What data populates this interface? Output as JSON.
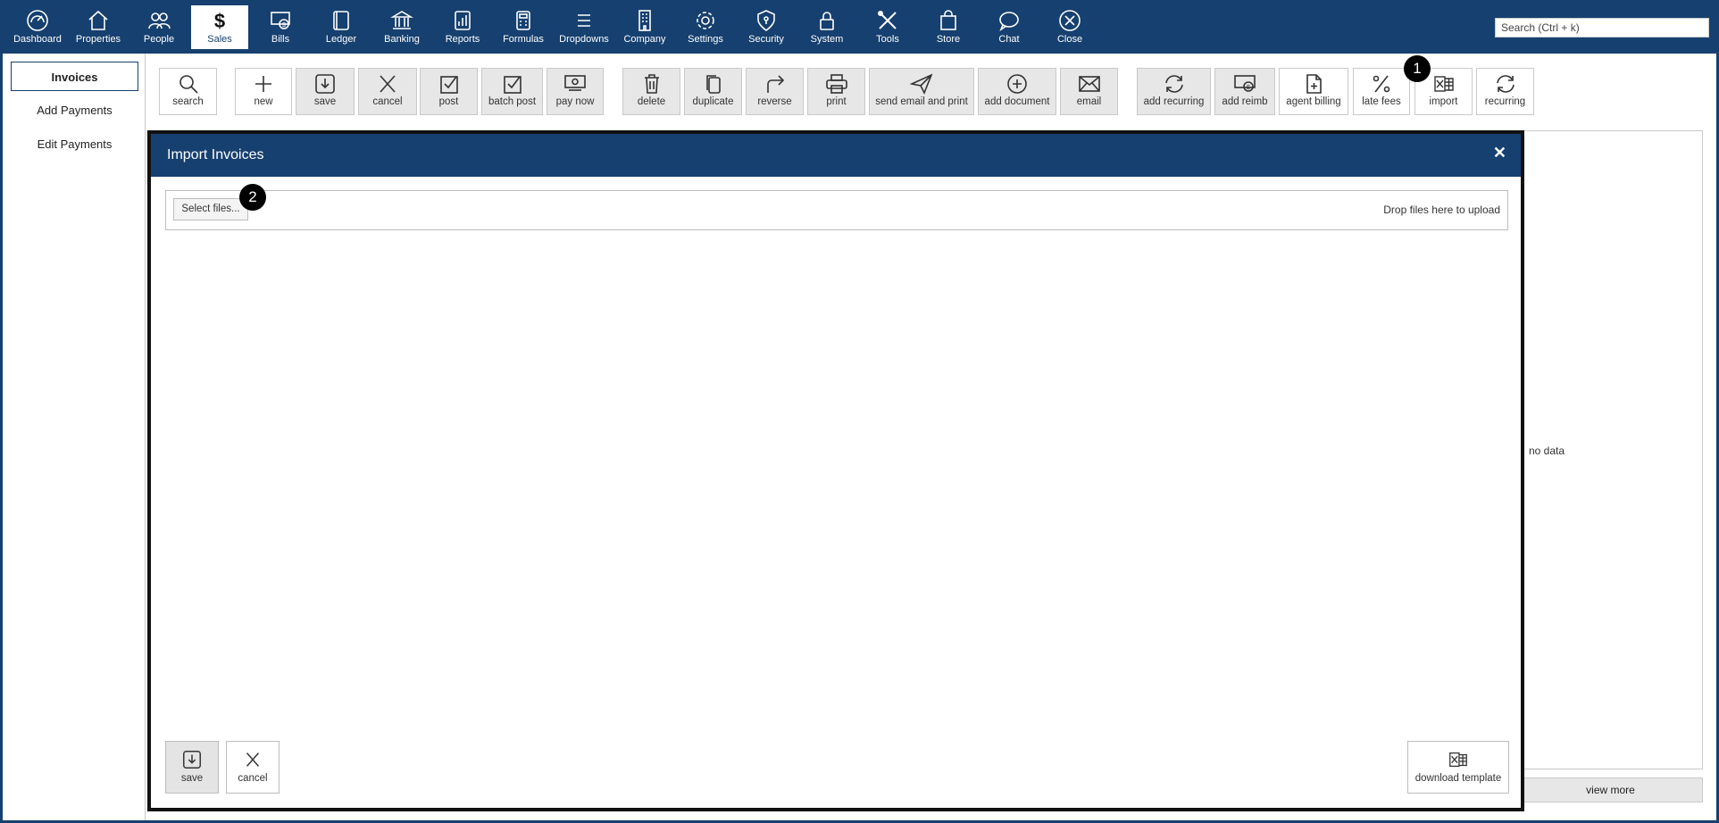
{
  "nav": {
    "items": [
      {
        "label": "Dashboard",
        "icon": "dashboard-icon"
      },
      {
        "label": "Properties",
        "icon": "home-icon"
      },
      {
        "label": "People",
        "icon": "people-icon"
      },
      {
        "label": "Sales",
        "icon": "dollar-icon",
        "active": true
      },
      {
        "label": "Bills",
        "icon": "bill-icon"
      },
      {
        "label": "Ledger",
        "icon": "ledger-icon"
      },
      {
        "label": "Banking",
        "icon": "bank-icon"
      },
      {
        "label": "Reports",
        "icon": "reports-icon"
      },
      {
        "label": "Formulas",
        "icon": "calculator-icon"
      },
      {
        "label": "Dropdowns",
        "icon": "list-icon"
      },
      {
        "label": "Company",
        "icon": "building-icon"
      },
      {
        "label": "Settings",
        "icon": "gear-icon"
      },
      {
        "label": "Security",
        "icon": "shield-icon"
      },
      {
        "label": "System",
        "icon": "lock-icon"
      },
      {
        "label": "Tools",
        "icon": "tools-icon"
      },
      {
        "label": "Store",
        "icon": "bag-icon"
      },
      {
        "label": "Chat",
        "icon": "chat-icon"
      },
      {
        "label": "Close",
        "icon": "close-circle-icon"
      }
    ],
    "search_placeholder": "Search (Ctrl + k)"
  },
  "sidebar": {
    "items": [
      {
        "label": "Invoices",
        "active": true
      },
      {
        "label": "Add Payments"
      },
      {
        "label": "Edit Payments"
      }
    ]
  },
  "toolbar": {
    "buttons": [
      {
        "label": "search",
        "icon": "search-icon"
      },
      {
        "label": "new",
        "icon": "plus-icon"
      },
      {
        "label": "save",
        "icon": "save-icon"
      },
      {
        "label": "cancel",
        "icon": "x-icon"
      },
      {
        "label": "post",
        "icon": "check-box-icon"
      },
      {
        "label": "batch post",
        "icon": "check-box-icon"
      },
      {
        "label": "pay now",
        "icon": "money-icon"
      },
      {
        "label": "delete",
        "icon": "trash-icon"
      },
      {
        "label": "duplicate",
        "icon": "copy-icon"
      },
      {
        "label": "reverse",
        "icon": "redo-arrow-icon"
      },
      {
        "label": "print",
        "icon": "printer-icon"
      },
      {
        "label": "send email and print",
        "icon": "send-icon"
      },
      {
        "label": "add document",
        "icon": "plus-circle-icon"
      },
      {
        "label": "email",
        "icon": "envelope-icon"
      },
      {
        "label": "add recurring",
        "icon": "refresh-icon"
      },
      {
        "label": "add reimb",
        "icon": "money-icon"
      },
      {
        "label": "agent billing",
        "icon": "document-add-icon"
      },
      {
        "label": "late fees",
        "icon": "percent-icon"
      },
      {
        "label": "import",
        "icon": "excel-icon"
      },
      {
        "label": "recurring",
        "icon": "refresh-icon"
      }
    ]
  },
  "grid": {
    "empty_text": "no data",
    "view_more_label": "view more"
  },
  "modal": {
    "title": "Import Invoices",
    "close_label": "✕",
    "select_files_label": "Select files...",
    "drop_text": "Drop files here to upload",
    "save_label": "save",
    "cancel_label": "cancel",
    "download_template_label": "download template"
  },
  "badges": [
    "1",
    "2"
  ],
  "colors": {
    "nav_bg": "#16406f",
    "button_bg": "#e7e7e7",
    "badge_bg": "#000000"
  }
}
